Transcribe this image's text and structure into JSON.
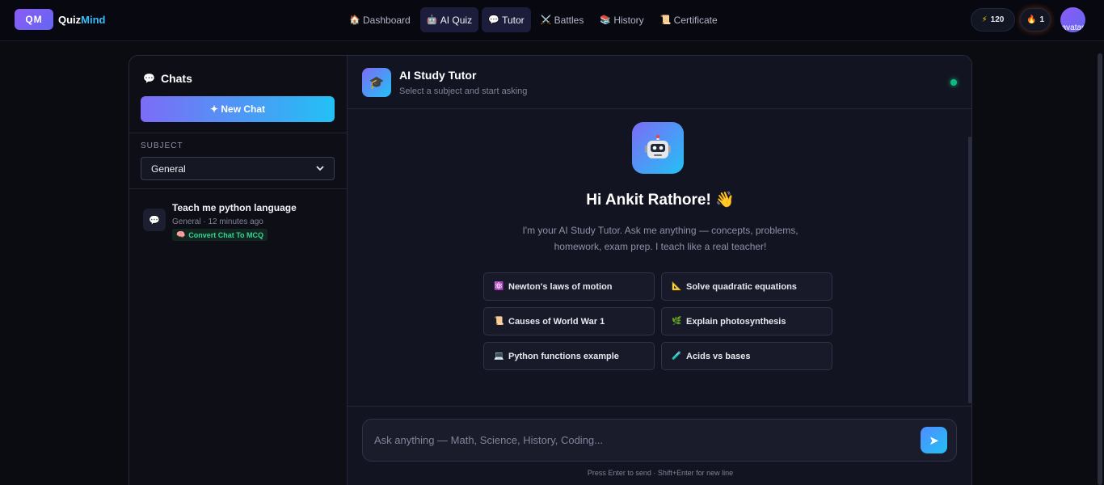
{
  "brand": {
    "badge": "QM",
    "name_main": "Quiz",
    "name_accent": "Mind"
  },
  "nav": [
    {
      "label": "Dashboard",
      "icon": "🏠",
      "active": false
    },
    {
      "label": "AI Quiz",
      "icon": "🤖",
      "active": true
    },
    {
      "label": "Tutor",
      "icon": "💬",
      "active": true
    },
    {
      "label": "Battles",
      "icon": "⚔️",
      "active": false
    },
    {
      "label": "History",
      "icon": "📚",
      "active": false
    },
    {
      "label": "Certificate",
      "icon": "📜",
      "active": false
    }
  ],
  "stats": {
    "xp_icon": "⚡",
    "xp": "120",
    "streak_icon": "🔥",
    "streak": "1"
  },
  "user": {
    "avatar_alt": "avatar"
  },
  "sidebar": {
    "title": "Chats",
    "title_icon": "💬",
    "new_chat_label": "✦ New Chat",
    "subject_label": "SUBJECT",
    "subject_value": "General",
    "chats": [
      {
        "title": "Teach me python language",
        "meta": "General · 12 minutes ago",
        "icon": "💬",
        "action": "Convert Chat To MCQ",
        "action_icon": "🧠"
      }
    ]
  },
  "header": {
    "icon": "🎓",
    "title": "AI Study Tutor",
    "subtitle": "Select a subject and start asking"
  },
  "welcome": {
    "greeting": "Hi Ankit Rathore! 👋",
    "intro": "I'm your AI Study Tutor. Ask me anything — concepts, problems, homework, exam prep. I teach like a real teacher!"
  },
  "suggestions": [
    {
      "icon": "⚛️",
      "label": "Newton's laws of motion"
    },
    {
      "icon": "📐",
      "label": "Solve quadratic equations"
    },
    {
      "icon": "📜",
      "label": "Causes of World War 1"
    },
    {
      "icon": "🌿",
      "label": "Explain photosynthesis"
    },
    {
      "icon": "💻",
      "label": "Python functions example"
    },
    {
      "icon": "🧪",
      "label": "Acids vs bases"
    }
  ],
  "composer": {
    "placeholder": "Ask anything — Math, Science, History, Coding...",
    "send_icon": "➤",
    "hint": "Press Enter to send · Shift+Enter for new line"
  },
  "colors": {
    "accent_start": "#7c6cf6",
    "accent_end": "#22c1f5",
    "online": "#10b981",
    "mcq": "#34d399"
  }
}
